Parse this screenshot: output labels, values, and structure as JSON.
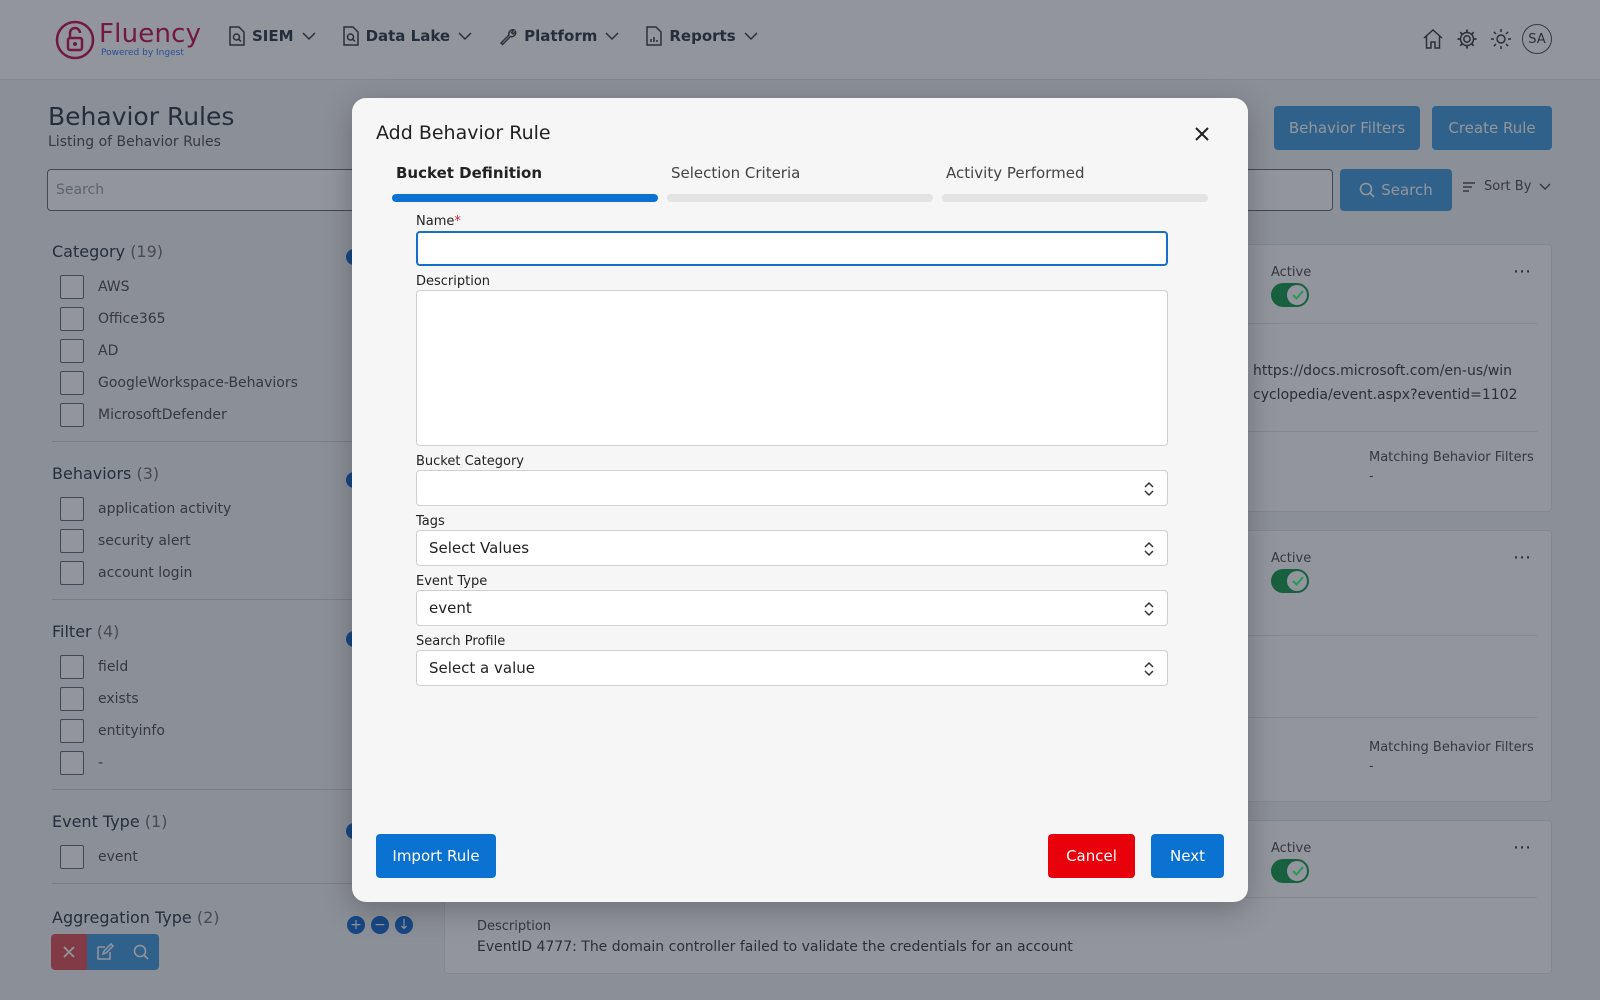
{
  "header": {
    "logo_name": "Fluency",
    "logo_sub": "Powered by Ingest",
    "nav": [
      {
        "label": "SIEM"
      },
      {
        "label": "Data Lake"
      },
      {
        "label": "Platform"
      },
      {
        "label": "Reports"
      }
    ],
    "avatar": "SA"
  },
  "page": {
    "title": "Behavior Rules",
    "subtitle": "Listing of Behavior Rules",
    "behavior_filters_label": "Behavior Filters",
    "create_rule_label": "Create Rule",
    "search_placeholder": "Search",
    "search_button": "Search",
    "sort_by": "Sort By"
  },
  "filters": [
    {
      "title": "Category",
      "count": "(19)",
      "items": [
        "AWS",
        "Office365",
        "AD",
        "GoogleWorkspace-Behaviors",
        "MicrosoftDefender"
      ]
    },
    {
      "title": "Behaviors",
      "count": "(3)",
      "items": [
        "application activity",
        "security alert",
        "account login"
      ]
    },
    {
      "title": "Filter",
      "count": "(4)",
      "items": [
        "field",
        "exists",
        "entityinfo",
        "-"
      ]
    },
    {
      "title": "Event Type",
      "count": "(1)",
      "items": [
        "event"
      ]
    },
    {
      "title": "Aggregation Type",
      "count": "(2)",
      "items": []
    }
  ],
  "cards": {
    "active_label": "Active",
    "link_line1": "https://docs.microsoft.com/en-us/win",
    "link_line2": "cyclopedia/event.aspx?eventid=1102",
    "matching_label": "Matching Behavior Filters",
    "matching_value": "-",
    "description_label": "Description",
    "description_value": "EventID 4777: The domain controller failed to validate the credentials for an account"
  },
  "modal": {
    "title": "Add Behavior Rule",
    "steps": [
      {
        "label": "Bucket Definition",
        "active": true
      },
      {
        "label": "Selection Criteria",
        "active": false
      },
      {
        "label": "Activity Performed",
        "active": false
      }
    ],
    "name_label": "Name",
    "name_required": "*",
    "name_value": "",
    "description_label": "Description",
    "description_value": "",
    "bucket_category_label": "Bucket Category",
    "bucket_category_value": "",
    "tags_label": "Tags",
    "tags_value": "Select Values",
    "event_type_label": "Event Type",
    "event_type_value": "event",
    "search_profile_label": "Search Profile",
    "search_profile_value": "Select a value",
    "import_button": "Import Rule",
    "cancel_button": "Cancel",
    "next_button": "Next"
  },
  "colors": {
    "primary": "#0b72d1",
    "danger": "#e8000b",
    "toggle_on": "#1f9d55",
    "brand": "#c2185b"
  }
}
